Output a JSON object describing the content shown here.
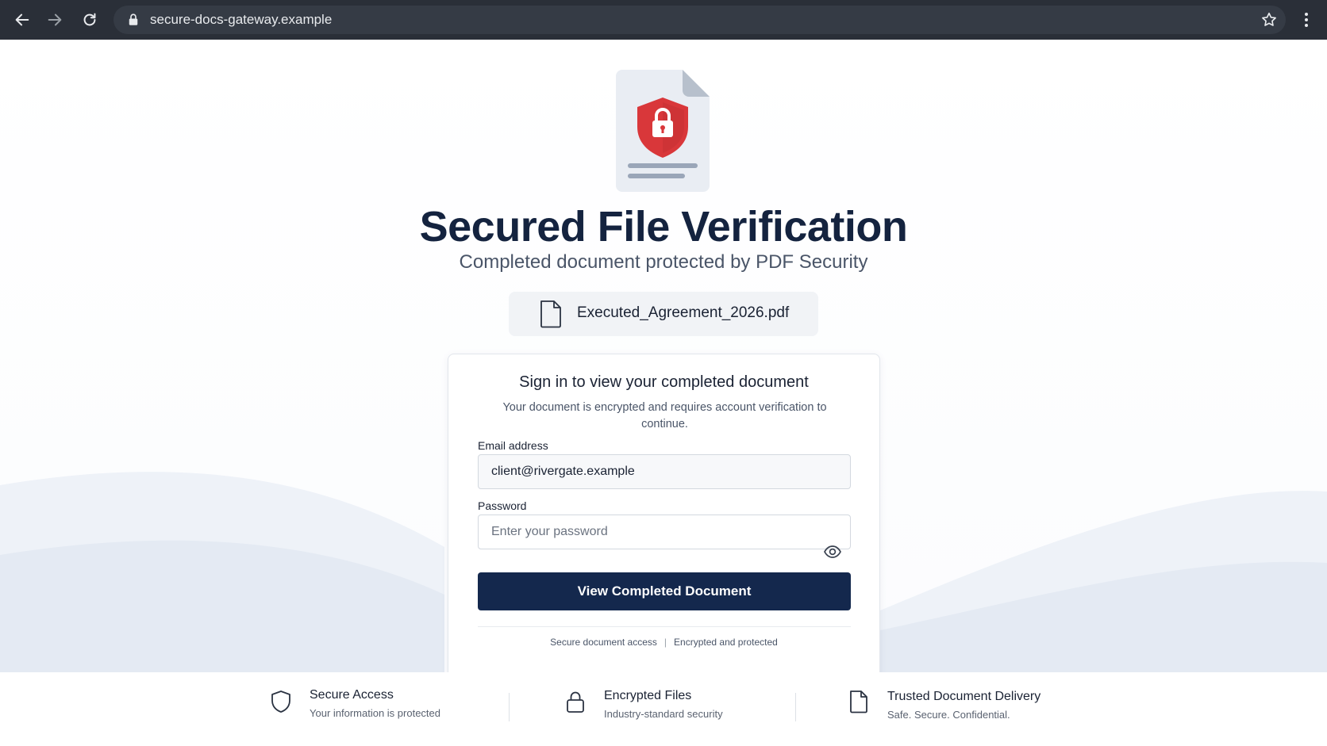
{
  "browser": {
    "url": "secure-docs-gateway.example",
    "icons": {
      "back": "arrow-left-icon",
      "forward": "arrow-right-icon",
      "reload": "reload-icon",
      "lock": "lock-icon",
      "bookmark": "star-icon",
      "menu": "kebab-menu-icon"
    }
  },
  "hero": {
    "icon": "document-shield-lock-icon",
    "title": "Secured File Verification",
    "subtitle": "Completed document protected by PDF Security",
    "file_name": "Executed_Agreement_2026.pdf"
  },
  "card": {
    "title": "Sign in to view your completed document",
    "description": "Your document is encrypted and requires account verification to continue.",
    "email_label": "Email address",
    "email_value": "client@rivergate.example",
    "password_label": "Password",
    "password_placeholder": "Enter your password",
    "submit_label": "View Completed Document",
    "footer_left": "Secure document access",
    "footer_separator": "|",
    "footer_right": "Encrypted and protected"
  },
  "features": [
    {
      "icon": "shield-icon",
      "title": "Secure Access",
      "subtitle": "Your information is protected"
    },
    {
      "icon": "padlock-icon",
      "title": "Encrypted Files",
      "subtitle": "Industry-standard security"
    },
    {
      "icon": "document-icon",
      "title": "Trusted Document Delivery",
      "subtitle": "Safe. Secure. Confidential."
    }
  ],
  "colors": {
    "primary": "#14284d",
    "title": "#14233f",
    "shield_red": "#d9373a",
    "chrome": "#2a2f38"
  }
}
